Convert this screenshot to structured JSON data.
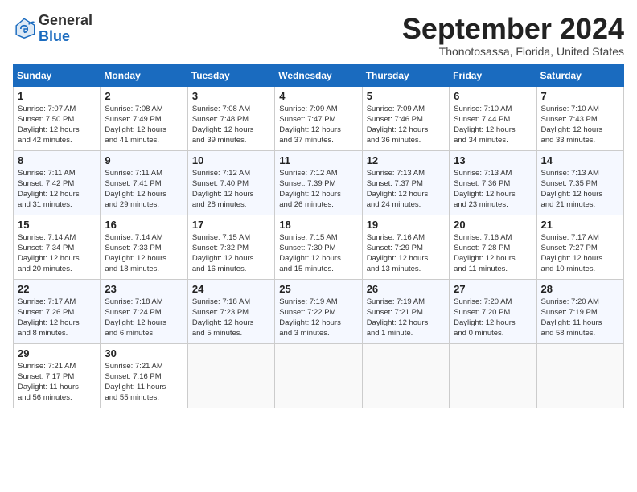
{
  "header": {
    "logo_general": "General",
    "logo_blue": "Blue",
    "month_title": "September 2024",
    "subtitle": "Thonotosassa, Florida, United States"
  },
  "calendar": {
    "days_of_week": [
      "Sunday",
      "Monday",
      "Tuesday",
      "Wednesday",
      "Thursday",
      "Friday",
      "Saturday"
    ],
    "weeks": [
      [
        {
          "day": "",
          "info": ""
        },
        {
          "day": "2",
          "info": "Sunrise: 7:08 AM\nSunset: 7:49 PM\nDaylight: 12 hours\nand 41 minutes."
        },
        {
          "day": "3",
          "info": "Sunrise: 7:08 AM\nSunset: 7:48 PM\nDaylight: 12 hours\nand 39 minutes."
        },
        {
          "day": "4",
          "info": "Sunrise: 7:09 AM\nSunset: 7:47 PM\nDaylight: 12 hours\nand 37 minutes."
        },
        {
          "day": "5",
          "info": "Sunrise: 7:09 AM\nSunset: 7:46 PM\nDaylight: 12 hours\nand 36 minutes."
        },
        {
          "day": "6",
          "info": "Sunrise: 7:10 AM\nSunset: 7:44 PM\nDaylight: 12 hours\nand 34 minutes."
        },
        {
          "day": "7",
          "info": "Sunrise: 7:10 AM\nSunset: 7:43 PM\nDaylight: 12 hours\nand 33 minutes."
        }
      ],
      [
        {
          "day": "1",
          "info": "Sunrise: 7:07 AM\nSunset: 7:50 PM\nDaylight: 12 hours\nand 42 minutes."
        },
        null,
        null,
        null,
        null,
        null,
        null
      ],
      [
        {
          "day": "8",
          "info": "Sunrise: 7:11 AM\nSunset: 7:42 PM\nDaylight: 12 hours\nand 31 minutes."
        },
        {
          "day": "9",
          "info": "Sunrise: 7:11 AM\nSunset: 7:41 PM\nDaylight: 12 hours\nand 29 minutes."
        },
        {
          "day": "10",
          "info": "Sunrise: 7:12 AM\nSunset: 7:40 PM\nDaylight: 12 hours\nand 28 minutes."
        },
        {
          "day": "11",
          "info": "Sunrise: 7:12 AM\nSunset: 7:39 PM\nDaylight: 12 hours\nand 26 minutes."
        },
        {
          "day": "12",
          "info": "Sunrise: 7:13 AM\nSunset: 7:37 PM\nDaylight: 12 hours\nand 24 minutes."
        },
        {
          "day": "13",
          "info": "Sunrise: 7:13 AM\nSunset: 7:36 PM\nDaylight: 12 hours\nand 23 minutes."
        },
        {
          "day": "14",
          "info": "Sunrise: 7:13 AM\nSunset: 7:35 PM\nDaylight: 12 hours\nand 21 minutes."
        }
      ],
      [
        {
          "day": "15",
          "info": "Sunrise: 7:14 AM\nSunset: 7:34 PM\nDaylight: 12 hours\nand 20 minutes."
        },
        {
          "day": "16",
          "info": "Sunrise: 7:14 AM\nSunset: 7:33 PM\nDaylight: 12 hours\nand 18 minutes."
        },
        {
          "day": "17",
          "info": "Sunrise: 7:15 AM\nSunset: 7:32 PM\nDaylight: 12 hours\nand 16 minutes."
        },
        {
          "day": "18",
          "info": "Sunrise: 7:15 AM\nSunset: 7:30 PM\nDaylight: 12 hours\nand 15 minutes."
        },
        {
          "day": "19",
          "info": "Sunrise: 7:16 AM\nSunset: 7:29 PM\nDaylight: 12 hours\nand 13 minutes."
        },
        {
          "day": "20",
          "info": "Sunrise: 7:16 AM\nSunset: 7:28 PM\nDaylight: 12 hours\nand 11 minutes."
        },
        {
          "day": "21",
          "info": "Sunrise: 7:17 AM\nSunset: 7:27 PM\nDaylight: 12 hours\nand 10 minutes."
        }
      ],
      [
        {
          "day": "22",
          "info": "Sunrise: 7:17 AM\nSunset: 7:26 PM\nDaylight: 12 hours\nand 8 minutes."
        },
        {
          "day": "23",
          "info": "Sunrise: 7:18 AM\nSunset: 7:24 PM\nDaylight: 12 hours\nand 6 minutes."
        },
        {
          "day": "24",
          "info": "Sunrise: 7:18 AM\nSunset: 7:23 PM\nDaylight: 12 hours\nand 5 minutes."
        },
        {
          "day": "25",
          "info": "Sunrise: 7:19 AM\nSunset: 7:22 PM\nDaylight: 12 hours\nand 3 minutes."
        },
        {
          "day": "26",
          "info": "Sunrise: 7:19 AM\nSunset: 7:21 PM\nDaylight: 12 hours\nand 1 minute."
        },
        {
          "day": "27",
          "info": "Sunrise: 7:20 AM\nSunset: 7:20 PM\nDaylight: 12 hours\nand 0 minutes."
        },
        {
          "day": "28",
          "info": "Sunrise: 7:20 AM\nSunset: 7:19 PM\nDaylight: 11 hours\nand 58 minutes."
        }
      ],
      [
        {
          "day": "29",
          "info": "Sunrise: 7:21 AM\nSunset: 7:17 PM\nDaylight: 11 hours\nand 56 minutes."
        },
        {
          "day": "30",
          "info": "Sunrise: 7:21 AM\nSunset: 7:16 PM\nDaylight: 11 hours\nand 55 minutes."
        },
        {
          "day": "",
          "info": ""
        },
        {
          "day": "",
          "info": ""
        },
        {
          "day": "",
          "info": ""
        },
        {
          "day": "",
          "info": ""
        },
        {
          "day": "",
          "info": ""
        }
      ]
    ]
  }
}
